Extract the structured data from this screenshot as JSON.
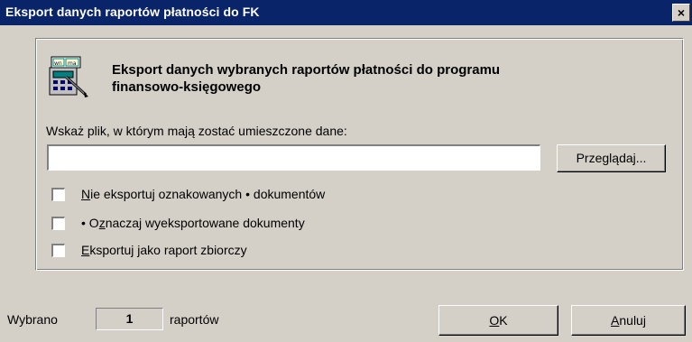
{
  "window": {
    "title": "Eksport danych raportów płatności do FK",
    "close_symbol": "×"
  },
  "main": {
    "heading_line1": "Eksport danych wybranych raportów płatności do programu",
    "heading_line2": "finansowo-księgowego",
    "file_label": "Wskaż plik, w którym mają zostać umieszczone dane:",
    "file_value": "",
    "browse_label_pre": "Prze",
    "browse_label_key": "g",
    "browse_label_post": "lądaj...",
    "icon": "document-calculator-pen-icon"
  },
  "options": [
    {
      "pre": "",
      "key": "N",
      "post": "ie eksportuj oznakowanych • dokumentów",
      "checked": false
    },
    {
      "pre": "• O",
      "key": "z",
      "post": "naczaj wyeksportowane dokumenty",
      "checked": false
    },
    {
      "pre": "",
      "key": "E",
      "post": "ksportuj jako raport zbiorczy",
      "checked": false
    }
  ],
  "footer": {
    "selected_prefix": "Wybrano",
    "selected_count": "1",
    "selected_suffix": "raportów",
    "ok_key": "O",
    "ok_rest": "K",
    "cancel_key": "A",
    "cancel_rest": "nuluj"
  },
  "colors": {
    "title_bar": "#0a246a",
    "face": "#d4d0c8"
  }
}
